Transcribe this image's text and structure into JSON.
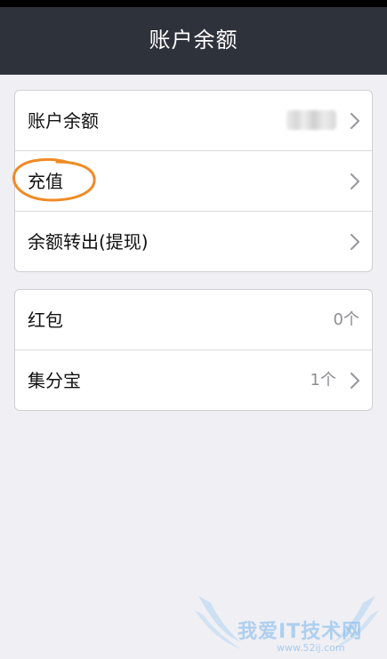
{
  "header": {
    "title": "账户余额"
  },
  "balance_card": {
    "items": [
      {
        "label": "账户余额",
        "value": "",
        "has_chevron": true,
        "value_blurred": true
      },
      {
        "label": "充值",
        "value": "",
        "has_chevron": true,
        "annotated": true
      },
      {
        "label": "余额转出(提现)",
        "value": "",
        "has_chevron": true
      }
    ]
  },
  "extras_card": {
    "items": [
      {
        "label": "红包",
        "value": "0个",
        "has_chevron": false
      },
      {
        "label": "集分宝",
        "value": "1个",
        "has_chevron": true
      }
    ]
  },
  "watermark": {
    "text": "我爱IT技术网",
    "subtext": "www.52ij.com"
  },
  "colors": {
    "header_bg": "#2e323b",
    "page_bg": "#efeff4",
    "annotation": "#f08a24",
    "chevron": "#9a9aa0",
    "value_text": "#8e8e93"
  },
  "icons": {
    "chevron": "chevron-right-icon",
    "watermark_wings": "wings-icon"
  }
}
